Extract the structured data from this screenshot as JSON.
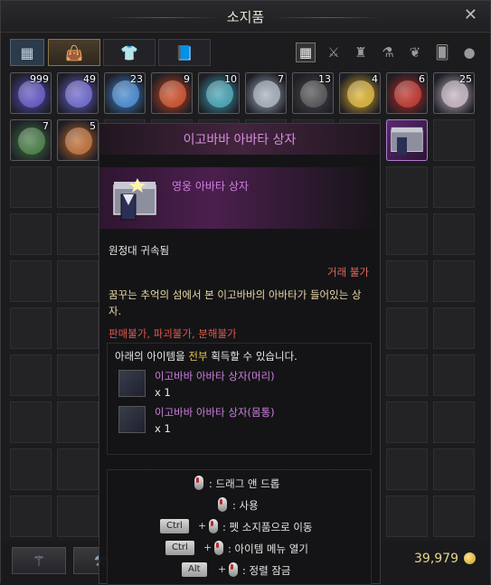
{
  "window": {
    "title": "소지품",
    "close_icon": "close-icon"
  },
  "tabs": [
    {
      "icon": "grid-icon"
    },
    {
      "icon": "bag-icon"
    },
    {
      "icon": "cloth-icon"
    },
    {
      "icon": "book-icon"
    }
  ],
  "filters": [
    {
      "icon": "grid-filter-icon"
    },
    {
      "icon": "swords-icon"
    },
    {
      "icon": "armor-icon"
    },
    {
      "icon": "potion-icon"
    },
    {
      "icon": "leaf-icon"
    },
    {
      "icon": "cards-icon"
    },
    {
      "icon": "more-icon"
    }
  ],
  "items": [
    {
      "count": "999",
      "color": "#5b4fc9"
    },
    {
      "count": "49",
      "color": "#6a63d6"
    },
    {
      "count": "23",
      "color": "#3d8ad8"
    },
    {
      "count": "9",
      "color": "#d2441a"
    },
    {
      "count": "10",
      "color": "#3ea6b8"
    },
    {
      "count": "7",
      "color": "#a9b3c2"
    },
    {
      "count": "13",
      "color": "#4a4a4a"
    },
    {
      "count": "4",
      "color": "#e3b429"
    },
    {
      "count": "6",
      "color": "#c4281f"
    },
    {
      "count": "25",
      "color": "#c9b8c4"
    },
    {
      "count": "7",
      "color": "#3f7a3c"
    },
    {
      "count": "5",
      "color": "#c46a2a"
    }
  ],
  "tooltip": {
    "header": "이고바바 아바타 상자",
    "item_name": "영웅 아바타 상자",
    "bind": "원정대 귀속됨",
    "trade": "거래 불가",
    "description": "꿈꾸는 추억의 섬에서 본 이고바바의 아바타가 들어있는 상자.",
    "restrictions": {
      "sell": "판매불가",
      "destroy": "파괴불가",
      "disassemble": "분해불가",
      "sep": ", "
    },
    "acquire_prefix": "아래의 아이템을 ",
    "acquire_all": "전부",
    "acquire_suffix": " 획득할 수 있습니다.",
    "rewards": [
      {
        "name": "이고바바 아바타 상자(머리)",
        "qty": "x 1"
      },
      {
        "name": "이고바바 아바타 상자(몸통)",
        "qty": "x 1"
      }
    ],
    "keys": [
      {
        "label": ": 드래그 앤 드롭"
      },
      {
        "label": ": 사용"
      },
      {
        "key": "Ctrl",
        "label": ": 펫 소지품으로 이동"
      },
      {
        "key": "Ctrl",
        "label": ": 아이템 메뉴 열기"
      },
      {
        "key": "Alt",
        "label": ": 정렬 잠금"
      }
    ]
  },
  "bottom": {
    "money": "39,979",
    "buttons": [
      "trident-icon",
      "hammer-icon"
    ]
  }
}
